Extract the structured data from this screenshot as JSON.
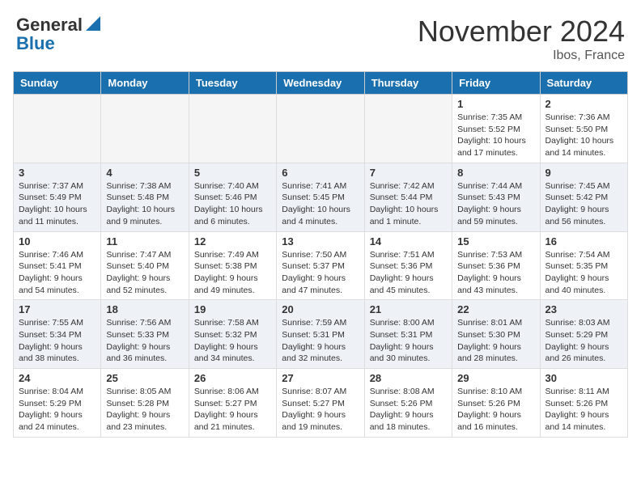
{
  "header": {
    "logo_text_general": "General",
    "logo_text_blue": "Blue",
    "month_title": "November 2024",
    "location": "Ibos, France"
  },
  "weekdays": [
    "Sunday",
    "Monday",
    "Tuesday",
    "Wednesday",
    "Thursday",
    "Friday",
    "Saturday"
  ],
  "weeks": [
    [
      {
        "day": "",
        "info": ""
      },
      {
        "day": "",
        "info": ""
      },
      {
        "day": "",
        "info": ""
      },
      {
        "day": "",
        "info": ""
      },
      {
        "day": "",
        "info": ""
      },
      {
        "day": "1",
        "info": "Sunrise: 7:35 AM\nSunset: 5:52 PM\nDaylight: 10 hours and 17 minutes."
      },
      {
        "day": "2",
        "info": "Sunrise: 7:36 AM\nSunset: 5:50 PM\nDaylight: 10 hours and 14 minutes."
      }
    ],
    [
      {
        "day": "3",
        "info": "Sunrise: 7:37 AM\nSunset: 5:49 PM\nDaylight: 10 hours and 11 minutes."
      },
      {
        "day": "4",
        "info": "Sunrise: 7:38 AM\nSunset: 5:48 PM\nDaylight: 10 hours and 9 minutes."
      },
      {
        "day": "5",
        "info": "Sunrise: 7:40 AM\nSunset: 5:46 PM\nDaylight: 10 hours and 6 minutes."
      },
      {
        "day": "6",
        "info": "Sunrise: 7:41 AM\nSunset: 5:45 PM\nDaylight: 10 hours and 4 minutes."
      },
      {
        "day": "7",
        "info": "Sunrise: 7:42 AM\nSunset: 5:44 PM\nDaylight: 10 hours and 1 minute."
      },
      {
        "day": "8",
        "info": "Sunrise: 7:44 AM\nSunset: 5:43 PM\nDaylight: 9 hours and 59 minutes."
      },
      {
        "day": "9",
        "info": "Sunrise: 7:45 AM\nSunset: 5:42 PM\nDaylight: 9 hours and 56 minutes."
      }
    ],
    [
      {
        "day": "10",
        "info": "Sunrise: 7:46 AM\nSunset: 5:41 PM\nDaylight: 9 hours and 54 minutes."
      },
      {
        "day": "11",
        "info": "Sunrise: 7:47 AM\nSunset: 5:40 PM\nDaylight: 9 hours and 52 minutes."
      },
      {
        "day": "12",
        "info": "Sunrise: 7:49 AM\nSunset: 5:38 PM\nDaylight: 9 hours and 49 minutes."
      },
      {
        "day": "13",
        "info": "Sunrise: 7:50 AM\nSunset: 5:37 PM\nDaylight: 9 hours and 47 minutes."
      },
      {
        "day": "14",
        "info": "Sunrise: 7:51 AM\nSunset: 5:36 PM\nDaylight: 9 hours and 45 minutes."
      },
      {
        "day": "15",
        "info": "Sunrise: 7:53 AM\nSunset: 5:36 PM\nDaylight: 9 hours and 43 minutes."
      },
      {
        "day": "16",
        "info": "Sunrise: 7:54 AM\nSunset: 5:35 PM\nDaylight: 9 hours and 40 minutes."
      }
    ],
    [
      {
        "day": "17",
        "info": "Sunrise: 7:55 AM\nSunset: 5:34 PM\nDaylight: 9 hours and 38 minutes."
      },
      {
        "day": "18",
        "info": "Sunrise: 7:56 AM\nSunset: 5:33 PM\nDaylight: 9 hours and 36 minutes."
      },
      {
        "day": "19",
        "info": "Sunrise: 7:58 AM\nSunset: 5:32 PM\nDaylight: 9 hours and 34 minutes."
      },
      {
        "day": "20",
        "info": "Sunrise: 7:59 AM\nSunset: 5:31 PM\nDaylight: 9 hours and 32 minutes."
      },
      {
        "day": "21",
        "info": "Sunrise: 8:00 AM\nSunset: 5:31 PM\nDaylight: 9 hours and 30 minutes."
      },
      {
        "day": "22",
        "info": "Sunrise: 8:01 AM\nSunset: 5:30 PM\nDaylight: 9 hours and 28 minutes."
      },
      {
        "day": "23",
        "info": "Sunrise: 8:03 AM\nSunset: 5:29 PM\nDaylight: 9 hours and 26 minutes."
      }
    ],
    [
      {
        "day": "24",
        "info": "Sunrise: 8:04 AM\nSunset: 5:29 PM\nDaylight: 9 hours and 24 minutes."
      },
      {
        "day": "25",
        "info": "Sunrise: 8:05 AM\nSunset: 5:28 PM\nDaylight: 9 hours and 23 minutes."
      },
      {
        "day": "26",
        "info": "Sunrise: 8:06 AM\nSunset: 5:27 PM\nDaylight: 9 hours and 21 minutes."
      },
      {
        "day": "27",
        "info": "Sunrise: 8:07 AM\nSunset: 5:27 PM\nDaylight: 9 hours and 19 minutes."
      },
      {
        "day": "28",
        "info": "Sunrise: 8:08 AM\nSunset: 5:26 PM\nDaylight: 9 hours and 18 minutes."
      },
      {
        "day": "29",
        "info": "Sunrise: 8:10 AM\nSunset: 5:26 PM\nDaylight: 9 hours and 16 minutes."
      },
      {
        "day": "30",
        "info": "Sunrise: 8:11 AM\nSunset: 5:26 PM\nDaylight: 9 hours and 14 minutes."
      }
    ]
  ]
}
